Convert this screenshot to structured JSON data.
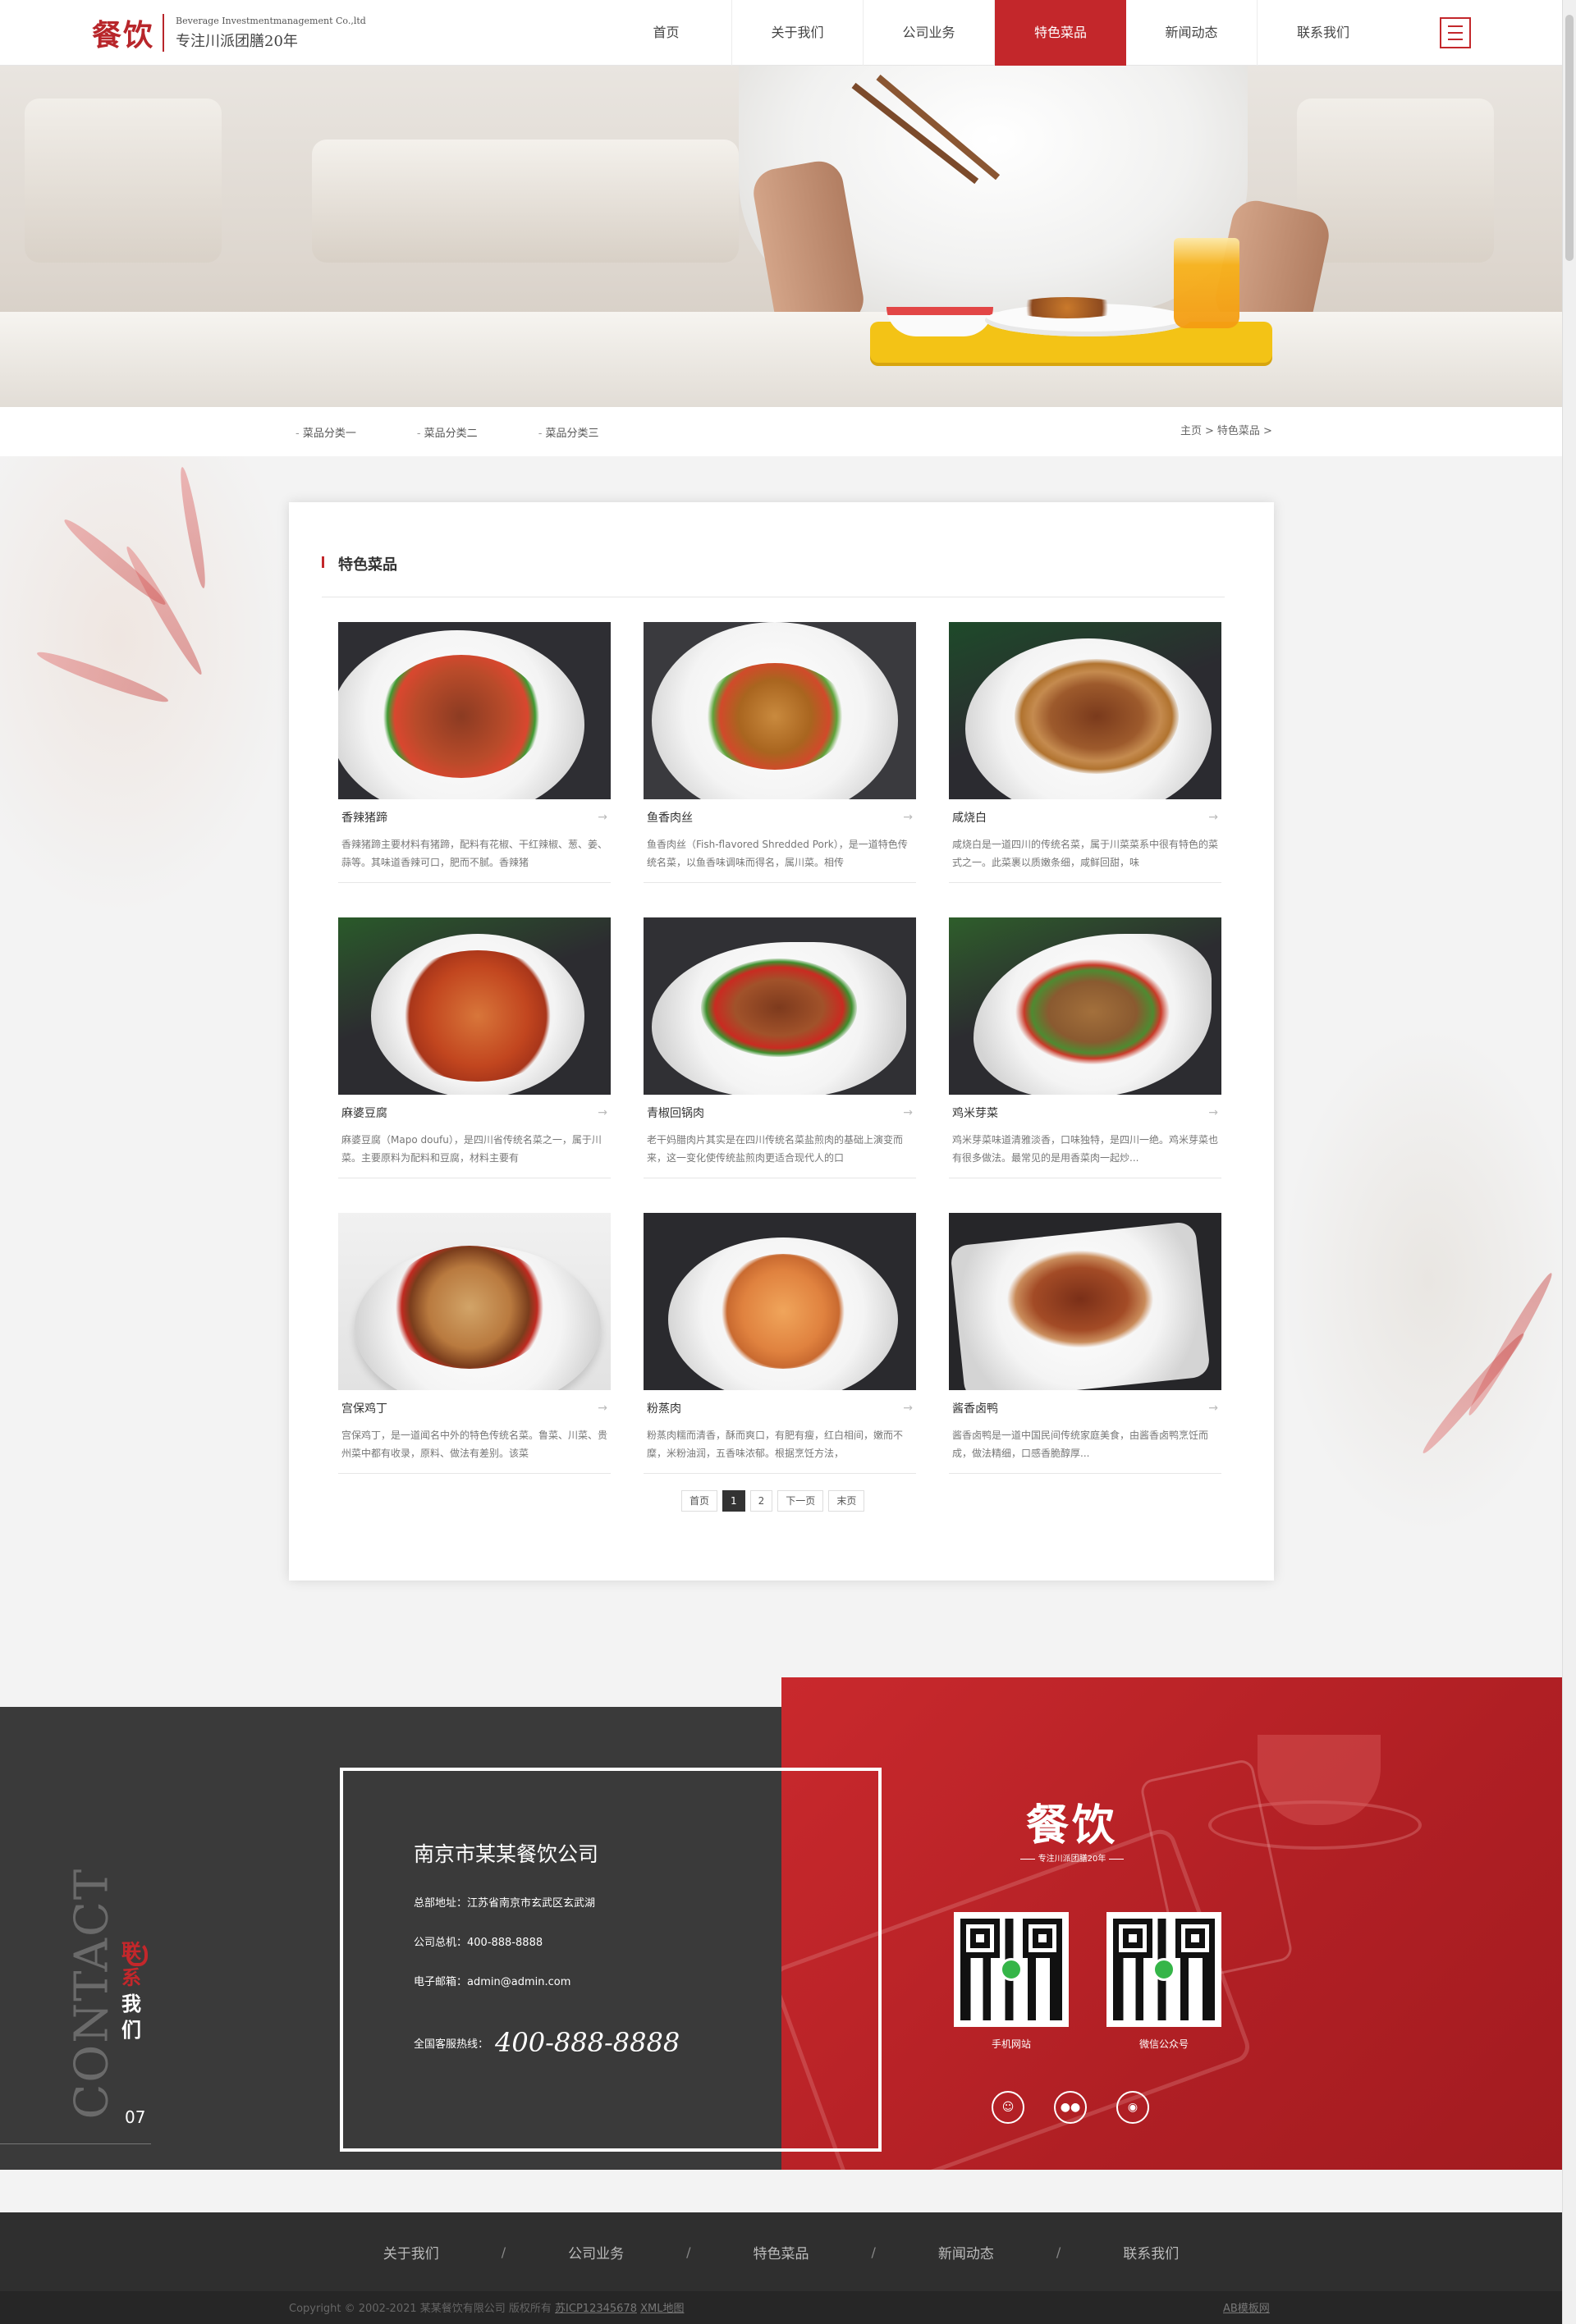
{
  "header": {
    "logo_mark": "餐饮",
    "logo_en": "Beverage Investmentmanagement Co.,ltd",
    "logo_slogan": "专注川派团膳20年",
    "nav": [
      "首页",
      "关于我们",
      "公司业务",
      "特色菜品",
      "新闻动态",
      "联系我们"
    ],
    "active_nav": "特色菜品"
  },
  "subnav": {
    "categories": [
      "菜品分类一",
      "菜品分类二",
      "菜品分类三"
    ],
    "breadcrumb": [
      "主页",
      "特色菜品"
    ]
  },
  "section": {
    "title": "特色菜品",
    "items": [
      {
        "name": "香辣猪蹄",
        "desc": "香辣猪蹄主要材料有猪蹄，配料有花椒、干红辣椒、葱、姜、蒜等。其味道香辣可口，肥而不腻。香辣猪"
      },
      {
        "name": "鱼香肉丝",
        "desc": "鱼香肉丝（Fish-flavored Shredded Pork），是一道特色传统名菜，以鱼香味调味而得名，属川菜。相传"
      },
      {
        "name": "咸烧白",
        "desc": "咸烧白是一道四川的传统名菜，属于川菜菜系中很有特色的菜式之一。此菜裹以质嫩条细，咸鲜回甜，味"
      },
      {
        "name": "麻婆豆腐",
        "desc": "麻婆豆腐（Mapo doufu），是四川省传统名菜之一，属于川菜。主要原料为配料和豆腐，材料主要有"
      },
      {
        "name": "青椒回锅肉",
        "desc": "老干妈腊肉片其实是在四川传统名菜盐煎肉的基础上演变而来，这一变化使传统盐煎肉更适合现代人的口"
      },
      {
        "name": "鸡米芽菜",
        "desc": "鸡米芽菜味道清雅淡香，口味独特，是四川一绝。鸡米芽菜也有很多做法。最常见的是用香菜肉一起炒..."
      },
      {
        "name": "宫保鸡丁",
        "desc": "宫保鸡丁，是一道闻名中外的特色传统名菜。鲁菜、川菜、贵州菜中都有收录，原料、做法有差别。该菜"
      },
      {
        "name": "粉蒸肉",
        "desc": "粉蒸肉糯而清香，酥而爽口，有肥有瘦，红白相间，嫩而不糜，米粉油润，五香味浓郁。根据烹饪方法，"
      },
      {
        "name": "酱香卤鸭",
        "desc": "酱香卤鸭是一道中国民间传统家庭美食，由酱香卤鸭烹饪而成，做法精细，口感香脆醇厚..."
      }
    ],
    "pagination": [
      "首页",
      "1",
      "2",
      "下一页",
      "末页"
    ],
    "current_page": "1"
  },
  "contact": {
    "company": "南京市某某餐饮公司",
    "address_label": "总部地址：",
    "address": "江苏省南京市玄武区玄武湖",
    "phone_label": "公司总机：",
    "phone": "400-888-8888",
    "email_label": "电子邮箱：",
    "email": "admin@admin.com",
    "hotline_label": "全国客服热线：",
    "hotline": "400-888-8888",
    "vertical_en": "CONTACT",
    "vertical_cn": [
      "联",
      "系",
      "我",
      "们"
    ],
    "vertical_num": "07",
    "brand_logo": "餐饮",
    "brand_slogan": "专注川派团膳20年",
    "qr_labels": [
      "手机网站",
      "微信公众号"
    ],
    "social_icons": [
      "qq-icon",
      "wechat-icon",
      "weibo-icon"
    ]
  },
  "footer": {
    "nav": [
      "关于我们",
      "公司业务",
      "特色菜品",
      "新闻动态",
      "联系我们"
    ],
    "separator": "/",
    "copyright": "Copyright © 2002-2021 某某餐饮有限公司 版权所有 ",
    "icp": "苏ICP12345678",
    "xml_map": "XML地图",
    "right_link": "AB模板网"
  },
  "colors": {
    "accent": "#c3272b",
    "footer_dark": "#3a3a3a"
  }
}
